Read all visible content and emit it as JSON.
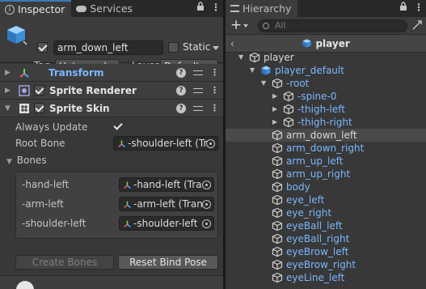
{
  "inspector": {
    "tabs": [
      {
        "label": "Inspector",
        "active": true
      },
      {
        "label": "Services",
        "active": false
      }
    ],
    "object_name": "arm_down_left",
    "active": true,
    "static_label": "Static",
    "static_checked": false,
    "tag_label": "Tag",
    "tag_value": "Untagged",
    "layer_label": "Layer",
    "layer_value": "Default",
    "components": [
      {
        "name": "Transform",
        "expanded": false,
        "has_checkbox": false
      },
      {
        "name": "Sprite Renderer",
        "expanded": false,
        "has_checkbox": true,
        "enabled": true
      },
      {
        "name": "Sprite Skin",
        "expanded": true,
        "has_checkbox": true,
        "enabled": true
      }
    ],
    "sprite_skin": {
      "always_update_label": "Always Update",
      "always_update": true,
      "root_bone_label": "Root Bone",
      "root_bone_value": "-shoulder-left (Tr",
      "bones_label": "Bones",
      "bones": [
        {
          "label": "-hand-left",
          "value": "-hand-left (Tra"
        },
        {
          "label": "-arm-left",
          "value": "-arm-left (Tran"
        },
        {
          "label": "-shoulder-left",
          "value": "-shoulder-left"
        }
      ],
      "create_bones_label": "Create Bones",
      "reset_bind_pose_label": "Reset Bind Pose"
    }
  },
  "hierarchy": {
    "tab_label": "Hierarchy",
    "add_label": "+",
    "search_placeholder": "All",
    "breadcrumb": "player",
    "nodes": [
      {
        "label": "player",
        "indent": 0,
        "arrow": "down",
        "color": "white",
        "icon": "gameobject"
      },
      {
        "label": "player_default",
        "indent": 1,
        "arrow": "down",
        "color": "blue",
        "icon": "prefab"
      },
      {
        "label": "-root",
        "indent": 2,
        "arrow": "down",
        "color": "blue",
        "icon": "gameobject"
      },
      {
        "label": "-spine-0",
        "indent": 3,
        "arrow": "right",
        "color": "blue",
        "icon": "gameobject"
      },
      {
        "label": "-thigh-left",
        "indent": 3,
        "arrow": "right",
        "color": "blue",
        "icon": "gameobject"
      },
      {
        "label": "-thigh-right",
        "indent": 3,
        "arrow": "right",
        "color": "blue",
        "icon": "gameobject"
      },
      {
        "label": "arm_down_left",
        "indent": 2,
        "arrow": "",
        "color": "white",
        "icon": "gameobject",
        "selected": true
      },
      {
        "label": "arm_down_right",
        "indent": 2,
        "arrow": "",
        "color": "blue",
        "icon": "gameobject"
      },
      {
        "label": "arm_up_left",
        "indent": 2,
        "arrow": "",
        "color": "blue",
        "icon": "gameobject"
      },
      {
        "label": "arm_up_right",
        "indent": 2,
        "arrow": "",
        "color": "blue",
        "icon": "gameobject"
      },
      {
        "label": "body",
        "indent": 2,
        "arrow": "",
        "color": "blue",
        "icon": "gameobject"
      },
      {
        "label": "eye_left",
        "indent": 2,
        "arrow": "",
        "color": "blue",
        "icon": "gameobject"
      },
      {
        "label": "eye_right",
        "indent": 2,
        "arrow": "",
        "color": "blue",
        "icon": "gameobject"
      },
      {
        "label": "eyeBall_left",
        "indent": 2,
        "arrow": "",
        "color": "blue",
        "icon": "gameobject"
      },
      {
        "label": "eyeBall_right",
        "indent": 2,
        "arrow": "",
        "color": "blue",
        "icon": "gameobject"
      },
      {
        "label": "eyeBrow_left",
        "indent": 2,
        "arrow": "",
        "color": "blue",
        "icon": "gameobject"
      },
      {
        "label": "eyeBrow_right",
        "indent": 2,
        "arrow": "",
        "color": "blue",
        "icon": "gameobject"
      },
      {
        "label": "eyeLine_left",
        "indent": 2,
        "arrow": "",
        "color": "blue",
        "icon": "gameobject"
      }
    ]
  },
  "colors": {
    "accent": "#3a79bb",
    "prefab_text": "#7ab7ff",
    "panel_bg": "#383838"
  }
}
